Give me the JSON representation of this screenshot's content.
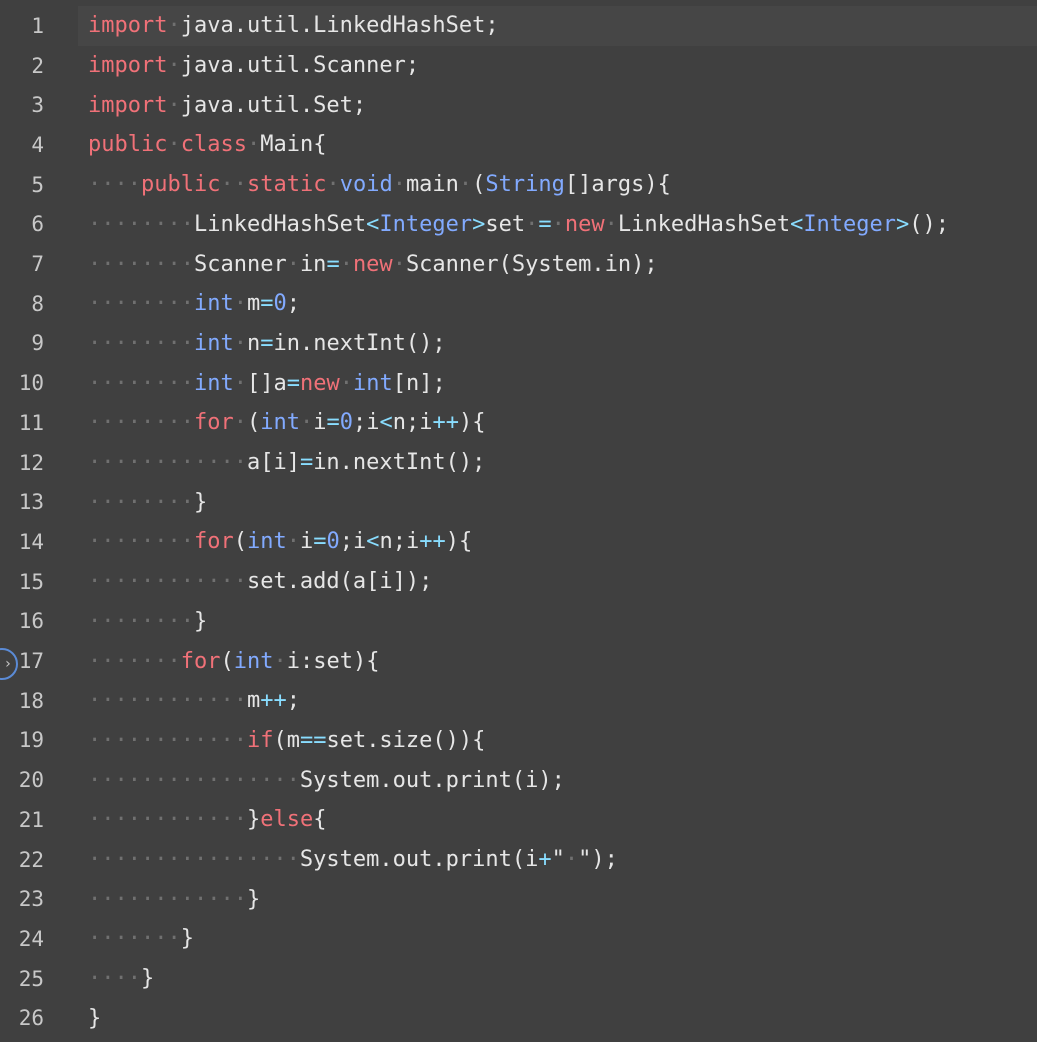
{
  "editor": {
    "current_line": 1,
    "fold_marker_icon": "chevron-right-icon",
    "lines": [
      {
        "num": "1",
        "tokens": [
          [
            "kw",
            "import"
          ],
          [
            "ws",
            "·"
          ],
          [
            "txt",
            "java.util.LinkedHashSet;"
          ]
        ]
      },
      {
        "num": "2",
        "tokens": [
          [
            "kw",
            "import"
          ],
          [
            "ws",
            "·"
          ],
          [
            "txt",
            "java.util.Scanner;"
          ]
        ]
      },
      {
        "num": "3",
        "tokens": [
          [
            "kw",
            "import"
          ],
          [
            "ws",
            "·"
          ],
          [
            "txt",
            "java.util.Set;"
          ]
        ]
      },
      {
        "num": "4",
        "tokens": [
          [
            "kw",
            "public"
          ],
          [
            "ws",
            "·"
          ],
          [
            "kw",
            "class"
          ],
          [
            "ws",
            "·"
          ],
          [
            "txt",
            "Main{"
          ]
        ]
      },
      {
        "num": "5",
        "tokens": [
          [
            "ws",
            "····"
          ],
          [
            "kw",
            "public"
          ],
          [
            "ws",
            "··"
          ],
          [
            "kw",
            "static"
          ],
          [
            "ws",
            "·"
          ],
          [
            "type",
            "void"
          ],
          [
            "ws",
            "·"
          ],
          [
            "txt",
            "main"
          ],
          [
            "ws",
            "·"
          ],
          [
            "txt",
            "("
          ],
          [
            "type",
            "String"
          ],
          [
            "txt",
            "[]args){"
          ]
        ]
      },
      {
        "num": "6",
        "tokens": [
          [
            "ws",
            "········"
          ],
          [
            "txt",
            "LinkedHashSet"
          ],
          [
            "op",
            "<"
          ],
          [
            "type",
            "Integer"
          ],
          [
            "op",
            ">"
          ],
          [
            "txt",
            "set"
          ],
          [
            "ws",
            "·"
          ],
          [
            "op",
            "="
          ],
          [
            "ws",
            "·"
          ],
          [
            "kw",
            "new"
          ],
          [
            "ws",
            "·"
          ],
          [
            "txt",
            "LinkedHashSet"
          ],
          [
            "op",
            "<"
          ],
          [
            "type",
            "Integer"
          ],
          [
            "op",
            ">"
          ],
          [
            "txt",
            "();"
          ]
        ]
      },
      {
        "num": "7",
        "tokens": [
          [
            "ws",
            "········"
          ],
          [
            "txt",
            "Scanner"
          ],
          [
            "ws",
            "·"
          ],
          [
            "txt",
            "in"
          ],
          [
            "op",
            "="
          ],
          [
            "ws",
            "·"
          ],
          [
            "kw",
            "new"
          ],
          [
            "ws",
            "·"
          ],
          [
            "txt",
            "Scanner(System.in);"
          ]
        ]
      },
      {
        "num": "8",
        "tokens": [
          [
            "ws",
            "········"
          ],
          [
            "type",
            "int"
          ],
          [
            "ws",
            "·"
          ],
          [
            "txt",
            "m"
          ],
          [
            "op",
            "="
          ],
          [
            "num",
            "0"
          ],
          [
            "txt",
            ";"
          ]
        ]
      },
      {
        "num": "9",
        "tokens": [
          [
            "ws",
            "········"
          ],
          [
            "type",
            "int"
          ],
          [
            "ws",
            "·"
          ],
          [
            "txt",
            "n"
          ],
          [
            "op",
            "="
          ],
          [
            "txt",
            "in.nextInt();"
          ]
        ]
      },
      {
        "num": "10",
        "tokens": [
          [
            "ws",
            "········"
          ],
          [
            "type",
            "int"
          ],
          [
            "ws",
            "·"
          ],
          [
            "txt",
            "[]a"
          ],
          [
            "op",
            "="
          ],
          [
            "kw",
            "new"
          ],
          [
            "ws",
            "·"
          ],
          [
            "type",
            "int"
          ],
          [
            "txt",
            "[n];"
          ]
        ]
      },
      {
        "num": "11",
        "tokens": [
          [
            "ws",
            "········"
          ],
          [
            "kw",
            "for"
          ],
          [
            "ws",
            "·"
          ],
          [
            "txt",
            "("
          ],
          [
            "type",
            "int"
          ],
          [
            "ws",
            "·"
          ],
          [
            "txt",
            "i"
          ],
          [
            "op",
            "="
          ],
          [
            "num",
            "0"
          ],
          [
            "txt",
            ";i"
          ],
          [
            "op",
            "<"
          ],
          [
            "txt",
            "n;i"
          ],
          [
            "op",
            "++"
          ],
          [
            "txt",
            "){"
          ]
        ]
      },
      {
        "num": "12",
        "tokens": [
          [
            "ws",
            "············"
          ],
          [
            "txt",
            "a[i]"
          ],
          [
            "op",
            "="
          ],
          [
            "txt",
            "in.nextInt();"
          ]
        ]
      },
      {
        "num": "13",
        "tokens": [
          [
            "ws",
            "········"
          ],
          [
            "txt",
            "}"
          ]
        ]
      },
      {
        "num": "14",
        "tokens": [
          [
            "ws",
            "········"
          ],
          [
            "kw",
            "for"
          ],
          [
            "txt",
            "("
          ],
          [
            "type",
            "int"
          ],
          [
            "ws",
            "·"
          ],
          [
            "txt",
            "i"
          ],
          [
            "op",
            "="
          ],
          [
            "num",
            "0"
          ],
          [
            "txt",
            ";i"
          ],
          [
            "op",
            "<"
          ],
          [
            "txt",
            "n;i"
          ],
          [
            "op",
            "++"
          ],
          [
            "txt",
            "){"
          ]
        ]
      },
      {
        "num": "15",
        "tokens": [
          [
            "ws",
            "············"
          ],
          [
            "txt",
            "set.add(a[i]);"
          ]
        ]
      },
      {
        "num": "16",
        "tokens": [
          [
            "ws",
            "········"
          ],
          [
            "txt",
            "}"
          ]
        ]
      },
      {
        "num": "17",
        "tokens": [
          [
            "ws",
            "·······"
          ],
          [
            "kw",
            "for"
          ],
          [
            "txt",
            "("
          ],
          [
            "type",
            "int"
          ],
          [
            "ws",
            "·"
          ],
          [
            "txt",
            "i:set){"
          ]
        ]
      },
      {
        "num": "18",
        "tokens": [
          [
            "ws",
            "············"
          ],
          [
            "txt",
            "m"
          ],
          [
            "op",
            "++"
          ],
          [
            "txt",
            ";"
          ]
        ]
      },
      {
        "num": "19",
        "tokens": [
          [
            "ws",
            "············"
          ],
          [
            "kw",
            "if"
          ],
          [
            "txt",
            "(m"
          ],
          [
            "op",
            "=="
          ],
          [
            "txt",
            "set.size()){"
          ]
        ]
      },
      {
        "num": "20",
        "tokens": [
          [
            "ws",
            "················"
          ],
          [
            "txt",
            "System.out.print(i);"
          ]
        ]
      },
      {
        "num": "21",
        "tokens": [
          [
            "ws",
            "············"
          ],
          [
            "txt",
            "}"
          ],
          [
            "kw",
            "else"
          ],
          [
            "txt",
            "{"
          ]
        ]
      },
      {
        "num": "22",
        "tokens": [
          [
            "ws",
            "················"
          ],
          [
            "txt",
            "System.out.print(i"
          ],
          [
            "op",
            "+"
          ],
          [
            "str",
            "\""
          ],
          [
            "ws",
            "·"
          ],
          [
            "str",
            "\");"
          ]
        ]
      },
      {
        "num": "23",
        "tokens": [
          [
            "ws",
            "············"
          ],
          [
            "txt",
            "}"
          ]
        ]
      },
      {
        "num": "24",
        "tokens": [
          [
            "ws",
            "·······"
          ],
          [
            "txt",
            "}"
          ]
        ]
      },
      {
        "num": "25",
        "tokens": [
          [
            "ws",
            "····"
          ],
          [
            "txt",
            "}"
          ]
        ]
      },
      {
        "num": "26",
        "tokens": [
          [
            "txt",
            "}"
          ]
        ]
      }
    ]
  }
}
